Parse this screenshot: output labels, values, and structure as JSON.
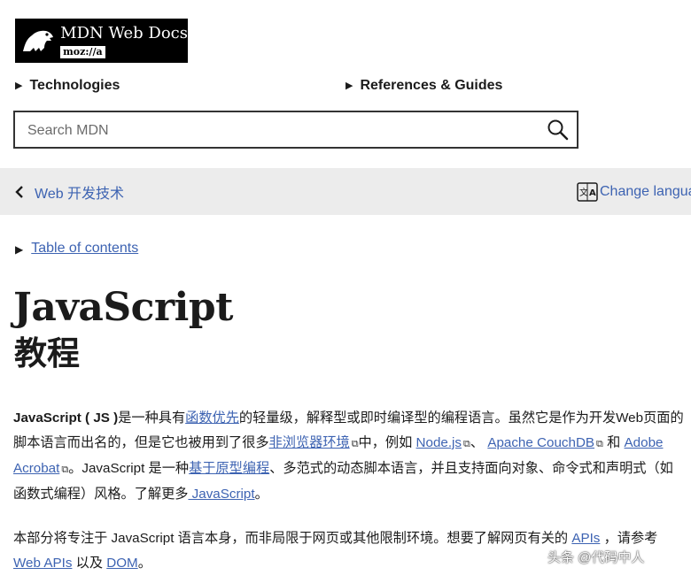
{
  "header": {
    "logo_title": "MDN Web Docs",
    "logo_sub": "moz://a",
    "nav": [
      {
        "label": "Technologies"
      },
      {
        "label": "References & Guides"
      }
    ]
  },
  "search": {
    "placeholder": "Search MDN"
  },
  "breadcrumb": {
    "back_label": "Web 开发技术",
    "change_language": "Change language"
  },
  "toc": {
    "label": "Table of contents"
  },
  "page": {
    "title": "JavaScript",
    "subtitle": "教程"
  },
  "paragraph1": {
    "bold_term": "JavaScript ( JS )",
    "t1": "是一种具有",
    "link1": "函数优先",
    "t2": "的轻量级，解释型或即时编译型的编程语言。虽然它是作为开发Web页面的脚本语言而出名的，但是它也被用到了很多",
    "link2": "非浏览器环境",
    "t3": "中，例如 ",
    "link3": "Node.js",
    "t4": "、 ",
    "link4": "Apache CouchDB",
    "t5": " 和 ",
    "link5": "Adobe Acrobat",
    "t6": "。JavaScript 是一种",
    "link6": "基于原型编程",
    "t7": "、多范式的动态脚本语言，并且支持面向对象、命令式和声明式（如函数式编程）风格。了解更多",
    "link7": " JavaScript",
    "t8": "。"
  },
  "paragraph2": {
    "t1": "本部分将专注于 JavaScript 语言本身，而非局限于网页或其他限制环境。想要了解网页有关的 ",
    "link1": "APIs",
    "t2": " ，请参考 ",
    "link2": "Web APIs",
    "t3": " 以及 ",
    "link3": "DOM",
    "t4": "。"
  },
  "watermark": {
    "text": "头条 @代码中人"
  },
  "icons": {
    "logo": "dinosaur-icon",
    "search": "magnifier-icon",
    "back": "chevron-left-icon",
    "language": "translate-icon",
    "external": "external-link-icon"
  },
  "colors": {
    "link": "#3d63b2",
    "breadcrumb_bg": "#ececec",
    "text": "#1b1b1b"
  }
}
